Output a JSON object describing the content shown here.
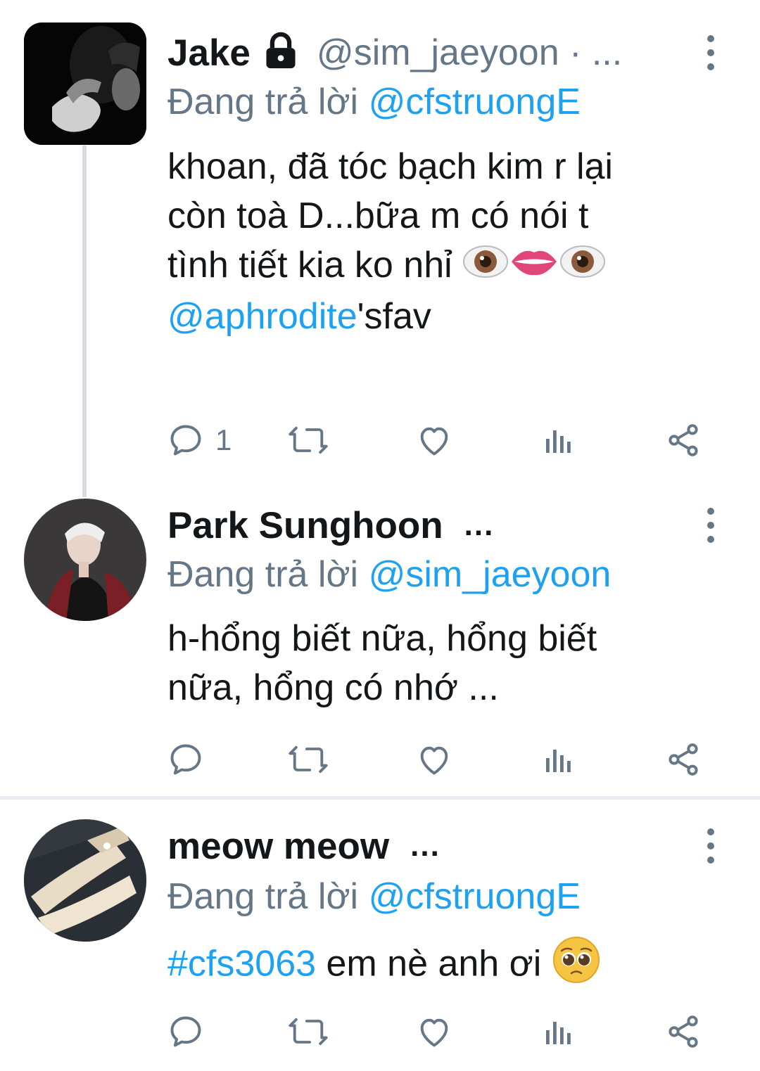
{
  "tweets": [
    {
      "name": "Jake",
      "locked": true,
      "handle": "@sim_jaeyoon · ...",
      "reply_prefix": "Đang trả lời",
      "reply_to": "@cfstruongE",
      "body_line1": "khoan, đã tóc bạch kim r lại",
      "body_line2": "còn toà D...bữa m có nói t",
      "body_line3": "tình tiết kia ko nhỉ",
      "body_emojis": [
        "eyes-emoji",
        "lips-emoji",
        "eyes-emoji"
      ],
      "body_mention": "@aphrodite",
      "body_mention_suffix": "'sfav",
      "reply_count": "1"
    },
    {
      "name": "Park Sunghoon",
      "ellipsis": "...",
      "reply_prefix": "Đang trả lời",
      "reply_to": "@sim_jaeyoon",
      "body_line1": "h-hổng biết nữa, hổng biết",
      "body_line2": "nữa, hổng có nhớ ..."
    },
    {
      "name": "meow meow",
      "ellipsis": "...",
      "reply_prefix": "Đang trả lời",
      "reply_to": "@cfstruongE",
      "body_hashtag": "#cfs3063",
      "body_text": "em nè anh ơi",
      "body_emoji": "pleading-face-emoji"
    }
  ],
  "colors": {
    "link": "#1da1f2",
    "secondary_text": "#657786",
    "primary_text": "#14171a",
    "divider": "#e6ecf0"
  },
  "icons": [
    "reply-icon",
    "retweet-icon",
    "like-icon",
    "analytics-icon",
    "share-icon",
    "more-options-icon",
    "lock-icon"
  ]
}
